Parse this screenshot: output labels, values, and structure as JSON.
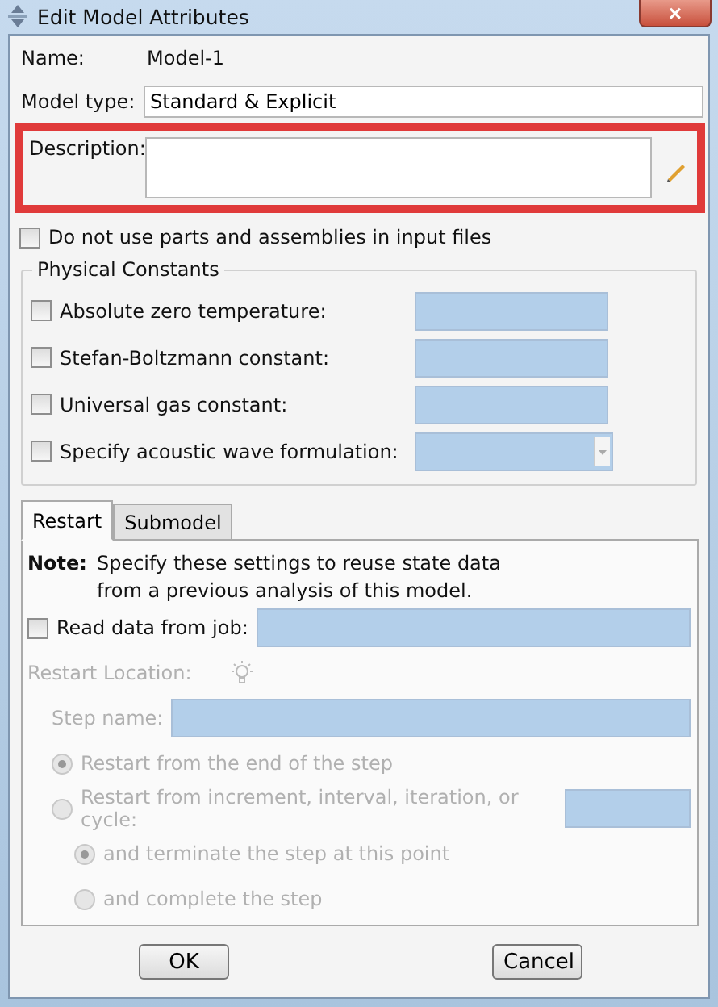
{
  "window": {
    "title": "Edit Model Attributes",
    "close_label": "×"
  },
  "name": {
    "label": "Name:",
    "value": "Model-1"
  },
  "model_type": {
    "label": "Model type:",
    "value": "Standard & Explicit"
  },
  "description": {
    "label": "Description:",
    "highlighted": true
  },
  "no_parts_option": {
    "label": "Do not use parts and assemblies in input files",
    "checked": false
  },
  "physical_constants": {
    "title": "Physical Constants",
    "items": [
      {
        "label": "Absolute zero temperature:",
        "checked": false,
        "kind": "field"
      },
      {
        "label": "Stefan-Boltzmann constant:",
        "checked": false,
        "kind": "field"
      },
      {
        "label": "Universal gas constant:",
        "checked": false,
        "kind": "field"
      },
      {
        "label": "Specify acoustic wave formulation:",
        "checked": false,
        "kind": "dropdown"
      }
    ]
  },
  "tabs": [
    {
      "label": "Restart",
      "selected": true
    },
    {
      "label": "Submodel",
      "selected": false
    }
  ],
  "restart": {
    "note_label": "Note:",
    "note_lines": [
      "Specify these settings to reuse state data",
      "from a previous analysis of this model."
    ],
    "read_data": {
      "label": "Read data from job:",
      "checked": false
    },
    "location_label": "Restart Location:",
    "disabled": true,
    "step_name_label": "Step name:",
    "options": [
      {
        "label": "Restart from the end of the step",
        "selected": true,
        "kind": "plain"
      },
      {
        "label": "Restart from increment, interval, iteration, or cycle:",
        "selected": false,
        "kind": "field"
      }
    ],
    "sub_options": [
      {
        "label": "and terminate the step at this point",
        "selected": true
      },
      {
        "label": "and complete the step",
        "selected": false
      }
    ]
  },
  "buttons": [
    {
      "label": "OK"
    },
    {
      "label": "Cancel"
    }
  ]
}
